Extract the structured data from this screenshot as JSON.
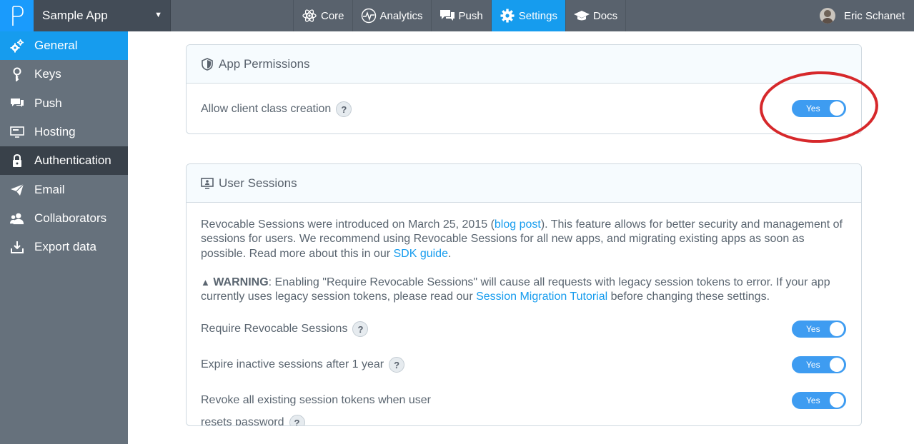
{
  "app": {
    "name": "Sample App"
  },
  "topnav": {
    "tabs": [
      {
        "label": "Core",
        "icon": "atom-icon"
      },
      {
        "label": "Analytics",
        "icon": "pulse-icon"
      },
      {
        "label": "Push",
        "icon": "chat-icon"
      },
      {
        "label": "Settings",
        "icon": "gear-icon",
        "active": true
      },
      {
        "label": "Docs",
        "icon": "graduation-cap-icon"
      }
    ],
    "user": "Eric Schanet"
  },
  "sidebar": {
    "items": [
      {
        "label": "General",
        "icon": "gears-icon",
        "state": "active"
      },
      {
        "label": "Keys",
        "icon": "key-icon"
      },
      {
        "label": "Push",
        "icon": "chat-icon"
      },
      {
        "label": "Hosting",
        "icon": "monitor-icon"
      },
      {
        "label": "Authentication",
        "icon": "lock-icon",
        "state": "highlighted"
      },
      {
        "label": "Email",
        "icon": "paper-plane-icon"
      },
      {
        "label": "Collaborators",
        "icon": "users-icon"
      },
      {
        "label": "Export data",
        "icon": "download-icon"
      }
    ]
  },
  "permissions": {
    "title": "App Permissions",
    "row_label": "Allow client class creation",
    "toggle": "Yes"
  },
  "sessions": {
    "title": "User Sessions",
    "intro_1": "Revocable Sessions were introduced on March 25, 2015 (",
    "intro_link_1": "blog post",
    "intro_2": "). This feature allows for better security and management of sessions for users. We recommend using Revocable Sessions for all new apps, and migrating existing apps as soon as possible. Read more about this in our ",
    "intro_link_2": "SDK guide",
    "intro_3": ".",
    "warning_label": "WARNING",
    "warning_1": ": Enabling \"Require Revocable Sessions\" will cause all requests with legacy session tokens to error. If your app currently uses legacy session tokens, please read our ",
    "warning_link": "Session Migration Tutorial",
    "warning_2": " before changing these settings.",
    "rows": [
      {
        "label": "Require Revocable Sessions",
        "toggle": "Yes"
      },
      {
        "label": "Expire inactive sessions after 1 year",
        "toggle": "Yes"
      },
      {
        "label_line1": "Revoke all existing session tokens when user",
        "label_line2": "resets password",
        "toggle": "Yes"
      }
    ]
  },
  "help_glyph": "?",
  "colors": {
    "accent": "#169cee",
    "sidebar": "#66717c",
    "topbar": "#59626d",
    "annotation": "#d6282b"
  }
}
